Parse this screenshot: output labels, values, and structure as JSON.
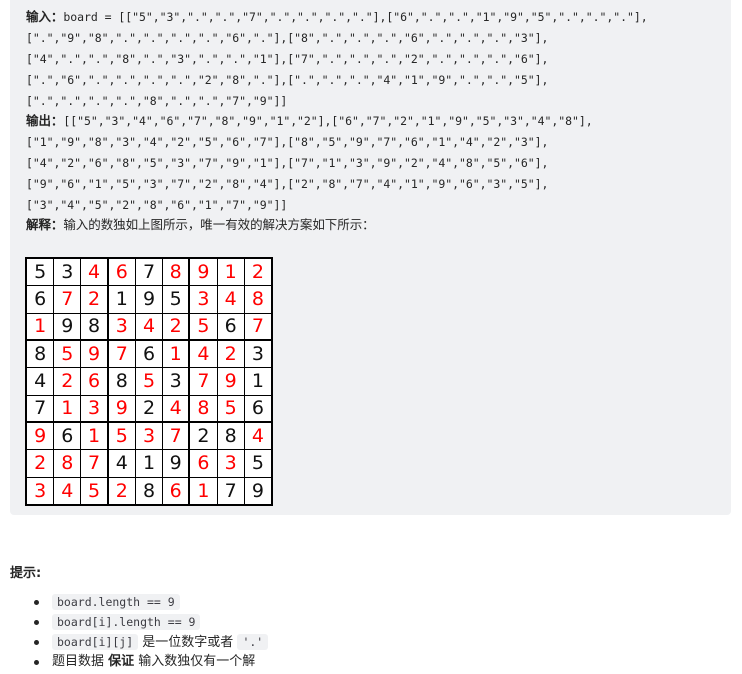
{
  "example": {
    "input_label": "输入：",
    "input_lines": [
      "board = [[\"5\",\"3\",\".\",\".\",\"7\",\".\",\".\",\".\",\".\"],[\"6\",\".\",\".\",\"1\",\"9\",\"5\",\".\",\".\",\".\"],",
      "[\".\",\"9\",\"8\",\".\",\".\",\".\",\".\",\"6\",\".\"],[\"8\",\".\",\".\",\".\",\"6\",\".\",\".\",\".\",\"3\"],",
      "[\"4\",\".\",\".\",\"8\",\".\",\"3\",\".\",\".\",\"1\"],[\"7\",\".\",\".\",\".\",\"2\",\".\",\".\",\".\",\"6\"],",
      "[\".\",\"6\",\".\",\".\",\".\",\".\",\"2\",\"8\",\".\"],[\".\",\".\",\".\",\"4\",\"1\",\"9\",\".\",\".\",\"5\"],",
      "[\".\",\".\",\".\",\".\",\"8\",\".\",\".\",\"7\",\"9\"]]"
    ],
    "output_label": "输出：",
    "output_lines": [
      "[[\"5\",\"3\",\"4\",\"6\",\"7\",\"8\",\"9\",\"1\",\"2\"],[\"6\",\"7\",\"2\",\"1\",\"9\",\"5\",\"3\",\"4\",\"8\"],",
      "[\"1\",\"9\",\"8\",\"3\",\"4\",\"2\",\"5\",\"6\",\"7\"],[\"8\",\"5\",\"9\",\"7\",\"6\",\"1\",\"4\",\"2\",\"3\"],",
      "[\"4\",\"2\",\"6\",\"8\",\"5\",\"3\",\"7\",\"9\",\"1\"],[\"7\",\"1\",\"3\",\"9\",\"2\",\"4\",\"8\",\"5\",\"6\"],",
      "[\"9\",\"6\",\"1\",\"5\",\"3\",\"7\",\"2\",\"8\",\"4\"],[\"2\",\"8\",\"7\",\"4\",\"1\",\"9\",\"6\",\"3\",\"5\"],",
      "[\"3\",\"4\",\"5\",\"2\",\"8\",\"6\",\"1\",\"7\",\"9\"]]"
    ],
    "explanation_label": "解释：",
    "explanation_text": "输入的数独如上图所示，唯一有效的解决方案如下所示："
  },
  "sudoku": {
    "solution": [
      "534678912",
      "672195348",
      "198342567",
      "859761423",
      "426853791",
      "713924856",
      "961537284",
      "287419635",
      "345286179"
    ],
    "given": [
      "53..7....",
      "6..195...",
      ".98....6.",
      "8...6...3",
      "4..8.3..1",
      "7...2...6",
      ".6....28.",
      "...419..5",
      "....8..79"
    ],
    "given_color": "#111111",
    "filled_color": "#ff0000"
  },
  "hints": {
    "title": "提示:",
    "items": [
      {
        "code": "board.length == 9",
        "text": "",
        "code2": ""
      },
      {
        "code": "board[i].length == 9",
        "text": "",
        "code2": ""
      },
      {
        "code": "board[i][j]",
        "text": " 是一位数字或者 ",
        "code2": "'.'"
      },
      {
        "pre": "题目数据 ",
        "bold": "保证",
        "post": " 输入数独仅有一个解"
      }
    ]
  }
}
